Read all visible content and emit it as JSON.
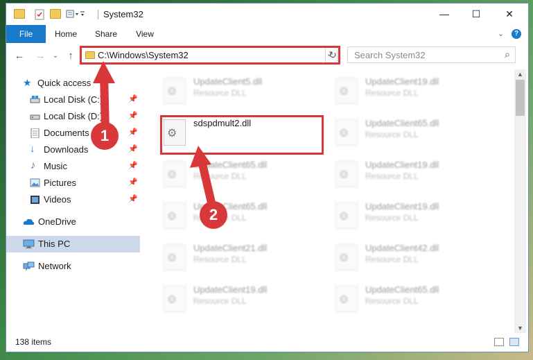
{
  "window": {
    "title": "System32",
    "controls": {
      "minimize": "—",
      "maximize": "☐",
      "close": "✕"
    }
  },
  "ribbon": {
    "tabs": [
      "File",
      "Home",
      "Share",
      "View"
    ],
    "collapse_icon": "chevron-down-icon",
    "help_icon": "help-icon"
  },
  "address_bar": {
    "path": "C:\\Windows\\System32",
    "search_placeholder": "Search System32"
  },
  "nav_pane": {
    "items": [
      {
        "label": "Quick access",
        "icon": "star-icon",
        "pinned": false
      },
      {
        "label": "Local Disk (C:)",
        "icon": "drive-icon",
        "pinned": true
      },
      {
        "label": "Local Disk (D:)",
        "icon": "drive-icon",
        "pinned": true
      },
      {
        "label": "Documents",
        "icon": "documents-icon",
        "pinned": true
      },
      {
        "label": "Downloads",
        "icon": "download-icon",
        "pinned": true
      },
      {
        "label": "Music",
        "icon": "music-icon",
        "pinned": true
      },
      {
        "label": "Pictures",
        "icon": "pictures-icon",
        "pinned": true
      },
      {
        "label": "Videos",
        "icon": "videos-icon",
        "pinned": true
      },
      {
        "label": "OneDrive",
        "icon": "cloud-icon",
        "pinned": false
      },
      {
        "label": "This PC",
        "icon": "computer-icon",
        "pinned": false,
        "selected": true
      },
      {
        "label": "Network",
        "icon": "network-icon",
        "pinned": false
      }
    ]
  },
  "files": [
    {
      "name": "UpdateClient5.dll",
      "type": "Resource DLL",
      "blurred": true
    },
    {
      "name": "UpdateClient19.dll",
      "type": "Resource DLL",
      "blurred": true
    },
    {
      "name": "sdspdmult2.dll",
      "type": "",
      "blurred": false,
      "highlighted": true
    },
    {
      "name": "UpdateClient65.dll",
      "type": "Resource DLL",
      "blurred": true
    },
    {
      "name": "UpdateClient65.dll",
      "type": "Resource DLL",
      "blurred": true
    },
    {
      "name": "UpdateClient19.dll",
      "type": "Resource DLL",
      "blurred": true
    },
    {
      "name": "UpdateClient65.dll",
      "type": "Resource DLL",
      "blurred": true
    },
    {
      "name": "UpdateClient19.dll",
      "type": "Resource DLL",
      "blurred": true
    },
    {
      "name": "UpdateClient21.dll",
      "type": "Resource DLL",
      "blurred": true
    },
    {
      "name": "UpdateClient42.dll",
      "type": "Resource DLL",
      "blurred": true
    },
    {
      "name": "UpdateClient19.dll",
      "type": "Resource DLL",
      "blurred": true
    },
    {
      "name": "UpdateClient65.dll",
      "type": "Resource DLL",
      "blurred": true
    }
  ],
  "status": {
    "item_count": "138 items"
  },
  "annotations": {
    "step1": "1",
    "step2": "2",
    "color": "#d9383a"
  }
}
